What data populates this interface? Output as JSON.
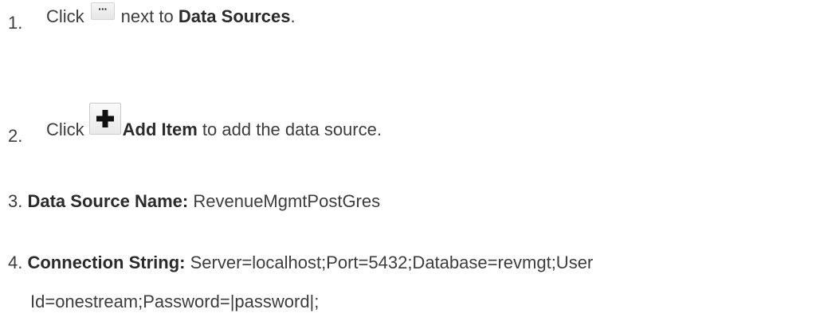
{
  "steps": [
    {
      "number": "1.",
      "prefix": "Click",
      "button_icon": "ellipsis-icon",
      "button_glyph": "···",
      "middle": "next to",
      "bold": "Data Sources",
      "suffix": "."
    },
    {
      "number": "2.",
      "prefix": "Click",
      "button_icon": "plus-icon",
      "bold": "Add Item",
      "suffix": "to add the data source."
    },
    {
      "number": "3.",
      "label": "Data Source Name:",
      "value": "RevenueMgmtPostGres"
    },
    {
      "number": "4.",
      "label": "Connection String:",
      "value_line1": "Server=localhost;Port=5432;Database=revmgt;User",
      "value_line2": "Id=onestream;Password=|password|;"
    }
  ]
}
